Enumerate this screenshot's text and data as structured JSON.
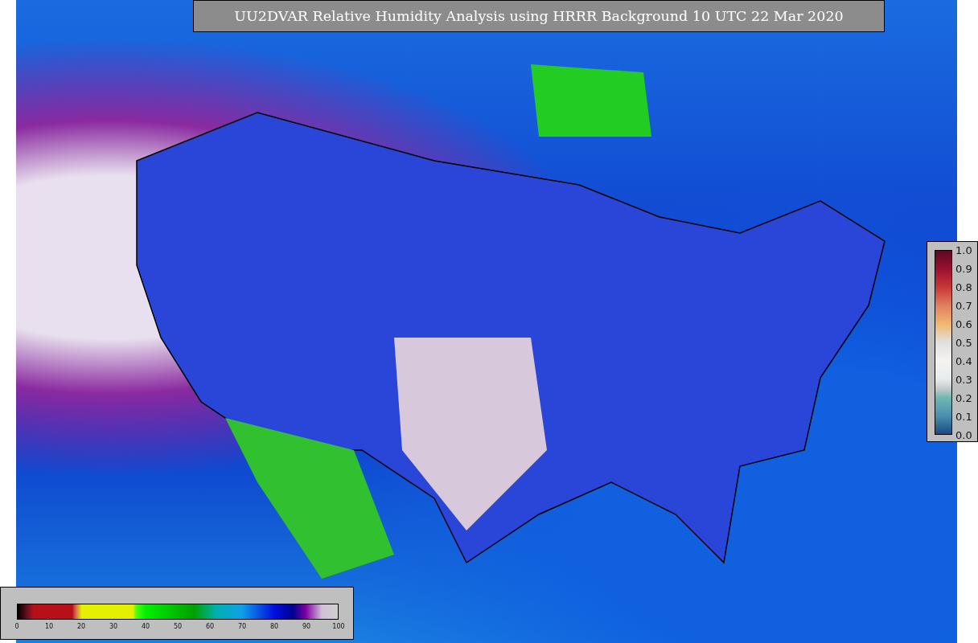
{
  "title": "UU2DVAR Relative Humidity Analysis using HRRR Background 10 UTC 22 Mar 2020",
  "humidity_colorbar": {
    "ticks": [
      "0",
      "10",
      "20",
      "30",
      "40",
      "50",
      "60",
      "70",
      "80",
      "90",
      "100"
    ]
  },
  "observation_colorbar": {
    "ticks": [
      "1.0",
      "0.9",
      "0.8",
      "0.7",
      "0.6",
      "0.5",
      "0.4",
      "0.3",
      "0.2",
      "0.1",
      "0.0"
    ]
  }
}
